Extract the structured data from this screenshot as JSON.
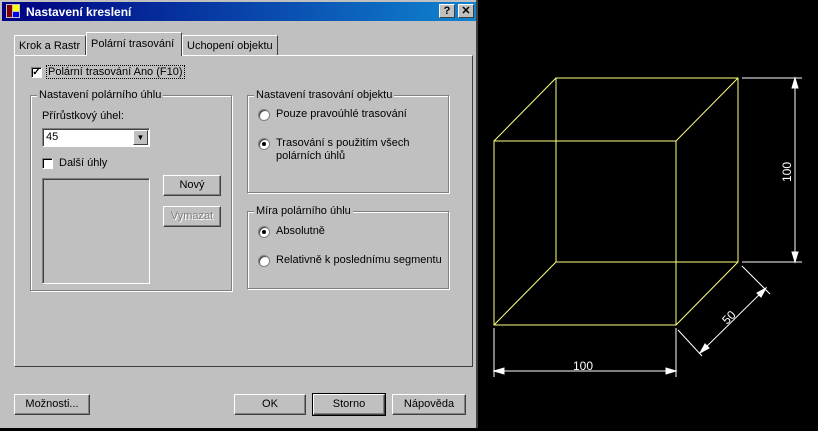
{
  "dialog": {
    "title": "Nastavení kreslení",
    "help_button": "?",
    "close_button": "✕",
    "tabs": [
      {
        "label": "Krok a Rastr"
      },
      {
        "label": "Polární trasování",
        "active": true
      },
      {
        "label": "Uchopení objektu"
      }
    ],
    "polar_on": {
      "label": "Polární trasování Ano (F10)",
      "checked": true
    },
    "polar_settings": {
      "title": "Nastavení polárního úhlu",
      "increment_label": "Přírůstkový úhel:",
      "increment_value": "45",
      "additional_label": "Další úhly",
      "additional_checked": false,
      "new_button": "Nový",
      "delete_button": "Vymazat"
    },
    "object_tracking": {
      "title": "Nastavení trasování objektu",
      "option1": "Pouze pravoúhlé trasování",
      "option2_line1": "Trasování s použitím všech",
      "option2_line2": "polárních úhlů",
      "selected": 2
    },
    "angle_measure": {
      "title": "Míra polárního úhlu",
      "option1": "Absolutně",
      "option2": "Relativně k poslednímu segmentu",
      "selected": 1
    },
    "buttons": {
      "options": "Možnosti...",
      "ok": "OK",
      "cancel": "Storno",
      "help": "Nápověda"
    }
  },
  "drawing": {
    "background": "#000000",
    "cube_color": "#ffff80",
    "dimension_color": "#ffffff",
    "dim_width": "100",
    "dim_height": "100",
    "dim_depth": "50"
  },
  "colors": {
    "titlebar_start": "#000080",
    "titlebar_end": "#1084d0",
    "face": "#c0c0c0"
  }
}
